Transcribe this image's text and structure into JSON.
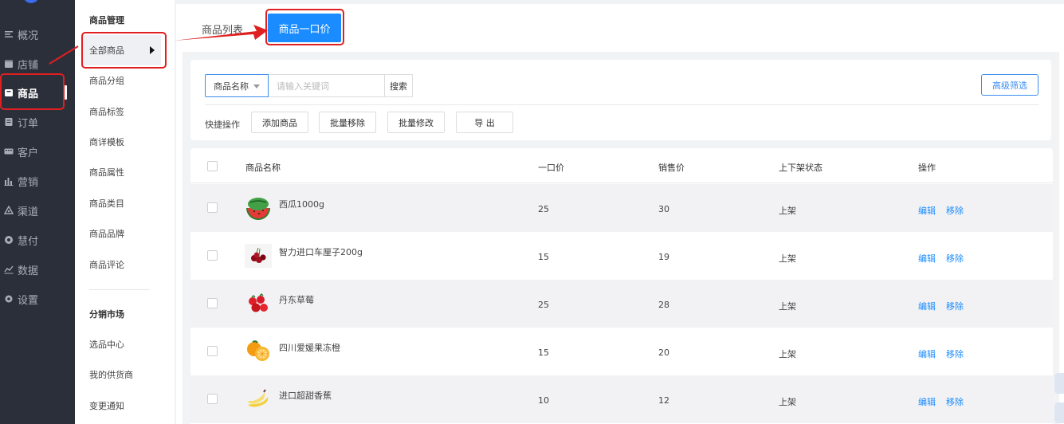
{
  "leftnav": {
    "items": [
      {
        "label": "概况",
        "icon": "list-icon"
      },
      {
        "label": "店铺",
        "icon": "store-icon"
      },
      {
        "label": "商品",
        "icon": "bag-icon"
      },
      {
        "label": "订单",
        "icon": "order-icon"
      },
      {
        "label": "客户",
        "icon": "customer-icon"
      },
      {
        "label": "营销",
        "icon": "chart-bars-icon"
      },
      {
        "label": "渠道",
        "icon": "channel-icon"
      },
      {
        "label": "慧付",
        "icon": "pay-icon"
      },
      {
        "label": "数据",
        "icon": "trend-icon"
      },
      {
        "label": "设置",
        "icon": "gear-icon"
      }
    ],
    "active_index": 2
  },
  "submenu": {
    "section1_title": "商品管理",
    "section1_items": [
      "全部商品",
      "商品分组",
      "商品标签",
      "商详模板",
      "商品属性",
      "商品类目",
      "商品品牌",
      "商品评论"
    ],
    "section2_title": "分销市场",
    "section2_items": [
      "选品中心",
      "我的供货商",
      "变更通知"
    ]
  },
  "tabs": {
    "list_label": "商品列表",
    "fixed_price_label": "商品一口价"
  },
  "filter": {
    "select_value": "商品名称",
    "keyword_placeholder": "请输入关键词",
    "search_label": "搜索",
    "advanced_label": "高级筛选",
    "quick_label": "快捷操作",
    "quick_buttons": [
      "添加商品",
      "批量移除",
      "批量修改",
      "导 出"
    ]
  },
  "table": {
    "headers": {
      "name": "商品名称",
      "fixed_price": "一口价",
      "sale_price": "销售价",
      "status": "上下架状态",
      "action": "操作"
    },
    "rows": [
      {
        "name": "西瓜1000g",
        "fixed_price": "25",
        "sale_price": "30",
        "status": "上架",
        "edit": "编辑",
        "remove": "移除",
        "thumb": "watermelon"
      },
      {
        "name": "智力进口车厘子200g",
        "fixed_price": "15",
        "sale_price": "19",
        "status": "上架",
        "edit": "编辑",
        "remove": "移除",
        "thumb": "cherry"
      },
      {
        "name": "丹东草莓",
        "fixed_price": "25",
        "sale_price": "28",
        "status": "上架",
        "edit": "编辑",
        "remove": "移除",
        "thumb": "strawberry"
      },
      {
        "name": "四川爱媛果冻橙",
        "fixed_price": "15",
        "sale_price": "20",
        "status": "上架",
        "edit": "编辑",
        "remove": "移除",
        "thumb": "orange"
      },
      {
        "name": "进口超甜香蕉",
        "fixed_price": "10",
        "sale_price": "12",
        "status": "上架",
        "edit": "编辑",
        "remove": "移除",
        "thumb": "banana"
      }
    ]
  },
  "colors": {
    "accent": "#1a8cff",
    "sidebar_bg": "#2b2f3a",
    "annotation_red": "#e02020"
  }
}
